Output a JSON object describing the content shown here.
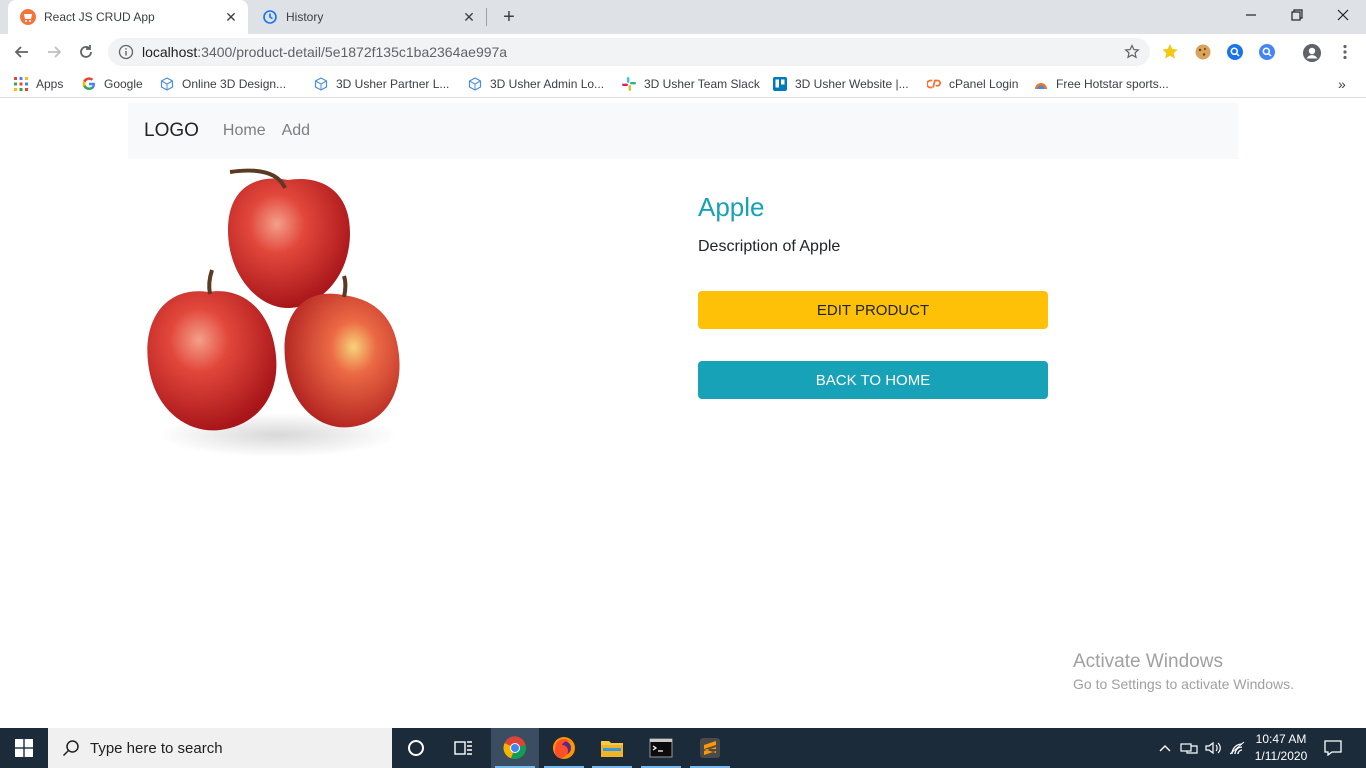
{
  "browser": {
    "tabs": [
      {
        "title": "React JS CRUD App",
        "active": true
      },
      {
        "title": "History",
        "active": false
      }
    ],
    "url_host": "localhost",
    "url_path": ":3400/product-detail/5e1872f135c1ba2364ae997a",
    "bookmarks": [
      "Apps",
      "Google",
      "Online 3D Design...",
      "3D Usher Partner L...",
      "3D Usher Admin Lo...",
      "3D Usher Team Slack",
      "3D Usher Website |...",
      "cPanel Login",
      "Free Hotstar sports..."
    ],
    "more_bookmarks": "»"
  },
  "navbar": {
    "brand": "LOGO",
    "links": [
      "Home",
      "Add"
    ]
  },
  "product": {
    "name": "Apple",
    "description": "Description of Apple",
    "edit_label": "EDIT PRODUCT",
    "back_label": "BACK TO HOME"
  },
  "watermark": {
    "line1": "Activate Windows",
    "line2": "Go to Settings to activate Windows."
  },
  "taskbar": {
    "search_placeholder": "Type here to search",
    "time": "10:47 AM",
    "date": "1/11/2020"
  },
  "colors": {
    "accent_info": "#17a2b8",
    "accent_warning": "#ffc107",
    "taskbar": "#1c2b3a"
  }
}
